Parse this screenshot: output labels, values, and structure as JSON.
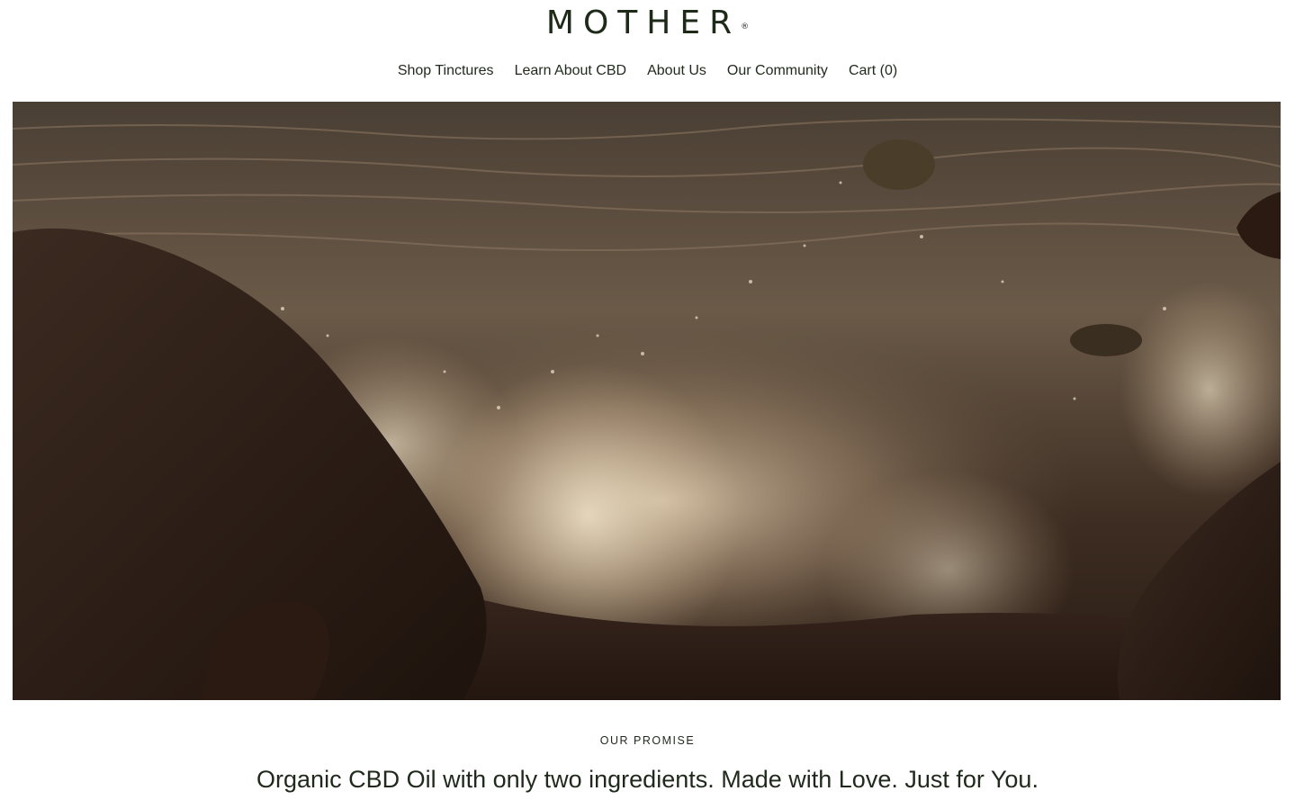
{
  "brand": {
    "logo_text": "MOTHER",
    "registered_mark": "®",
    "color": "#1d2a17"
  },
  "nav": {
    "items": [
      {
        "label": "Shop Tinctures"
      },
      {
        "label": "Learn About CBD"
      },
      {
        "label": "About Us"
      },
      {
        "label": "Our Community"
      },
      {
        "label": "Cart (0)"
      }
    ]
  },
  "hero": {
    "image_name": "ocean-waves-crashing-rocks-image"
  },
  "promise": {
    "label": "OUR PROMISE",
    "headline": "Organic CBD Oil with only two ingredients. Made with Love. Just for You."
  }
}
